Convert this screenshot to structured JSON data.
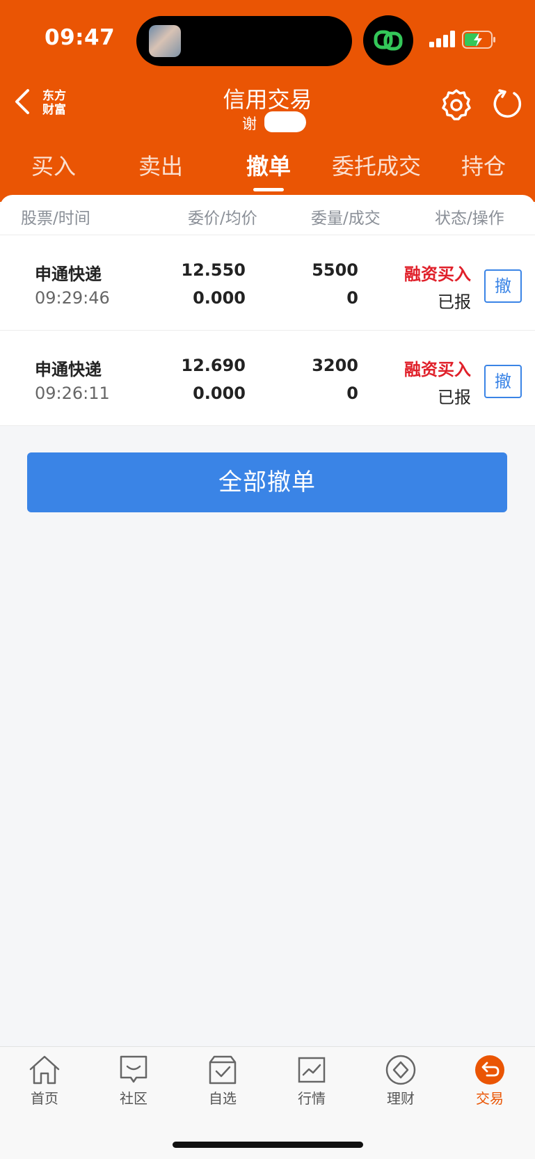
{
  "status_bar": {
    "time": "09:47"
  },
  "header": {
    "title": "信用交易",
    "subtitle": "谢",
    "logo_line1": "东方",
    "logo_line2": "财富",
    "back_icon": "chevron-left-icon",
    "settings_icon": "gear-icon",
    "refresh_icon": "refresh-icon",
    "background_color": "#ea5504"
  },
  "tabs": [
    {
      "label": "买入",
      "active": false
    },
    {
      "label": "卖出",
      "active": false
    },
    {
      "label": "撤单",
      "active": true
    },
    {
      "label": "委托成交",
      "active": false
    },
    {
      "label": "持仓",
      "active": false
    }
  ],
  "table": {
    "headers": [
      "股票/时间",
      "委价/均价",
      "委量/成交",
      "状态/操作"
    ],
    "rows": [
      {
        "name": "申通快递",
        "time": "09:29:46",
        "price": "12.550",
        "avg_price": "0.000",
        "qty": "5500",
        "filled": "0",
        "order_type": "融资买入",
        "status": "已报",
        "action": "撤"
      },
      {
        "name": "申通快递",
        "time": "09:26:11",
        "price": "12.690",
        "avg_price": "0.000",
        "qty": "3200",
        "filled": "0",
        "order_type": "融资买入",
        "status": "已报",
        "action": "撤"
      }
    ]
  },
  "cancel_all_label": "全部撤单",
  "bottom_nav": [
    {
      "label": "首页",
      "icon": "home-icon",
      "active": false
    },
    {
      "label": "社区",
      "icon": "chat-icon",
      "active": false
    },
    {
      "label": "自选",
      "icon": "watchlist-icon",
      "active": false
    },
    {
      "label": "行情",
      "icon": "market-chart-icon",
      "active": false
    },
    {
      "label": "理财",
      "icon": "wealth-diamond-icon",
      "active": false
    },
    {
      "label": "交易",
      "icon": "trade-icon",
      "active": true
    }
  ],
  "colors": {
    "accent": "#ea5504",
    "primary_button": "#3a84e6",
    "buy_type": "#e0202a"
  }
}
